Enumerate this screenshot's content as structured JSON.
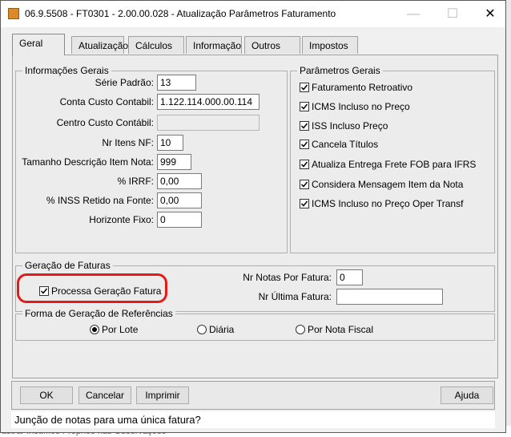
{
  "window": {
    "title": "06.9.5508 - FT0301 - 2.00.00.028 - Atualização Parâmetros Faturamento",
    "minimize": "—",
    "maximize": "☐",
    "close": "✕"
  },
  "tabs": [
    {
      "label": "Geral",
      "active": true
    },
    {
      "label": "Atualização"
    },
    {
      "label": "Cálculos"
    },
    {
      "label": "Informação"
    },
    {
      "label": "Outros"
    },
    {
      "label": "Impostos"
    }
  ],
  "info_gerais": {
    "title": "Informações Gerais",
    "fields": [
      {
        "label": "Série Padrão:",
        "value": "13"
      },
      {
        "label": "Conta Custo Contabil:",
        "value": "1.122.114.000.00.114"
      },
      {
        "label": "Centro Custo Contábil:",
        "value": ""
      },
      {
        "label": "Nr Itens NF:",
        "value": "10"
      },
      {
        "label": "Tamanho Descrição Item Nota:",
        "value": "999"
      },
      {
        "label": "% IRRF:",
        "value": "0,00"
      },
      {
        "label": "% INSS Retido na Fonte:",
        "value": "0,00"
      },
      {
        "label": "Horizonte Fixo:",
        "value": "0"
      }
    ]
  },
  "param_gerais": {
    "title": "Parâmetros Gerais",
    "items": [
      {
        "label": "Faturamento Retroativo",
        "checked": true
      },
      {
        "label": "ICMS Incluso no Preço",
        "checked": true
      },
      {
        "label": "ISS Incluso Preço",
        "checked": true
      },
      {
        "label": "Cancela Títulos",
        "checked": true
      },
      {
        "label": "Atualiza Entrega Frete FOB para IFRS",
        "checked": true
      },
      {
        "label": "Considera Mensagem Item da Nota",
        "checked": true
      },
      {
        "label": "ICMS Incluso no Preço Oper Transf",
        "checked": true
      }
    ]
  },
  "geracao": {
    "title": "Geração de Faturas",
    "processa_label": "Processa Geração Fatura",
    "nr_notas_label": "Nr Notas Por Fatura:",
    "nr_notas_value": "0",
    "nr_ultima_label": "Nr Última Fatura:",
    "nr_ultima_value": ""
  },
  "forma": {
    "title": "Forma de Geração de Referências",
    "options": [
      {
        "label": "Por Lote",
        "selected": true
      },
      {
        "label": "Diária"
      },
      {
        "label": "Por Nota Fiscal"
      }
    ]
  },
  "buttons": {
    "ok": "OK",
    "cancel": "Cancelar",
    "print": "Imprimir",
    "help": "Ajuda"
  },
  "status": "Junção de notas para uma única fatura?",
  "background_text": "astrar Insumos Próprios nas Observações",
  "colors": {
    "highlight": "#e31b1b"
  }
}
